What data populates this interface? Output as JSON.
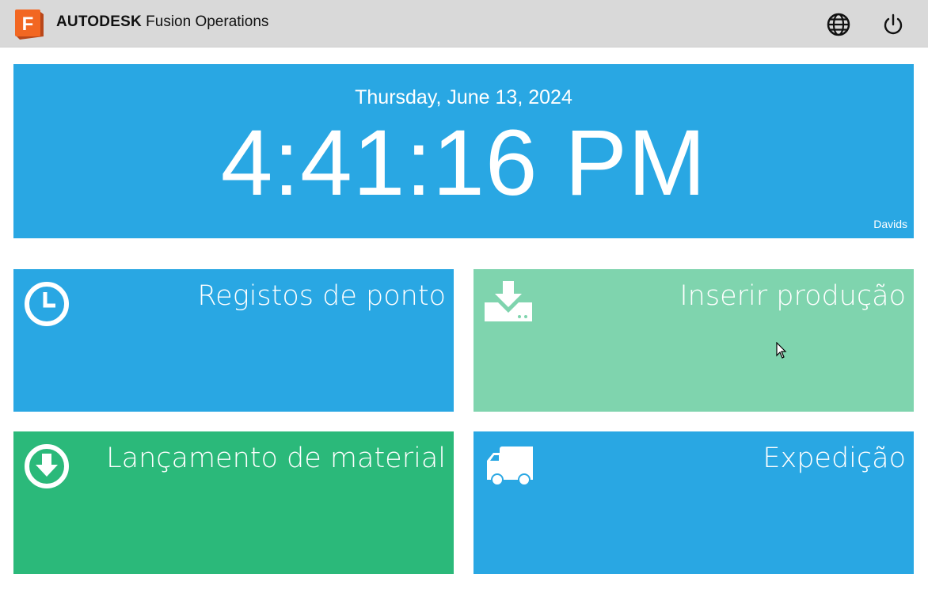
{
  "header": {
    "brand_bold": "AUTODESK",
    "product": "Fusion Operations",
    "logo_letter": "F",
    "icons": [
      "globe-icon",
      "power-icon"
    ]
  },
  "clock": {
    "date": "Thursday, June 13, 2024",
    "time": "4:41:16 PM",
    "user": "Davids"
  },
  "tiles": [
    {
      "label": "Registos de ponto",
      "icon": "clock-icon",
      "color": "#29a7e3"
    },
    {
      "label": "Inserir produção",
      "icon": "download-tray-icon",
      "color": "#7fd4ae"
    },
    {
      "label": "Lançamento de material",
      "icon": "arrow-down-circle-icon",
      "color": "#2bb97a"
    },
    {
      "label": "Expedição",
      "icon": "truck-icon",
      "color": "#29a7e3"
    }
  ],
  "colors": {
    "header_bg": "#d9d9d9",
    "panel_blue": "#29a7e3",
    "logo_orange": "#f26722"
  }
}
